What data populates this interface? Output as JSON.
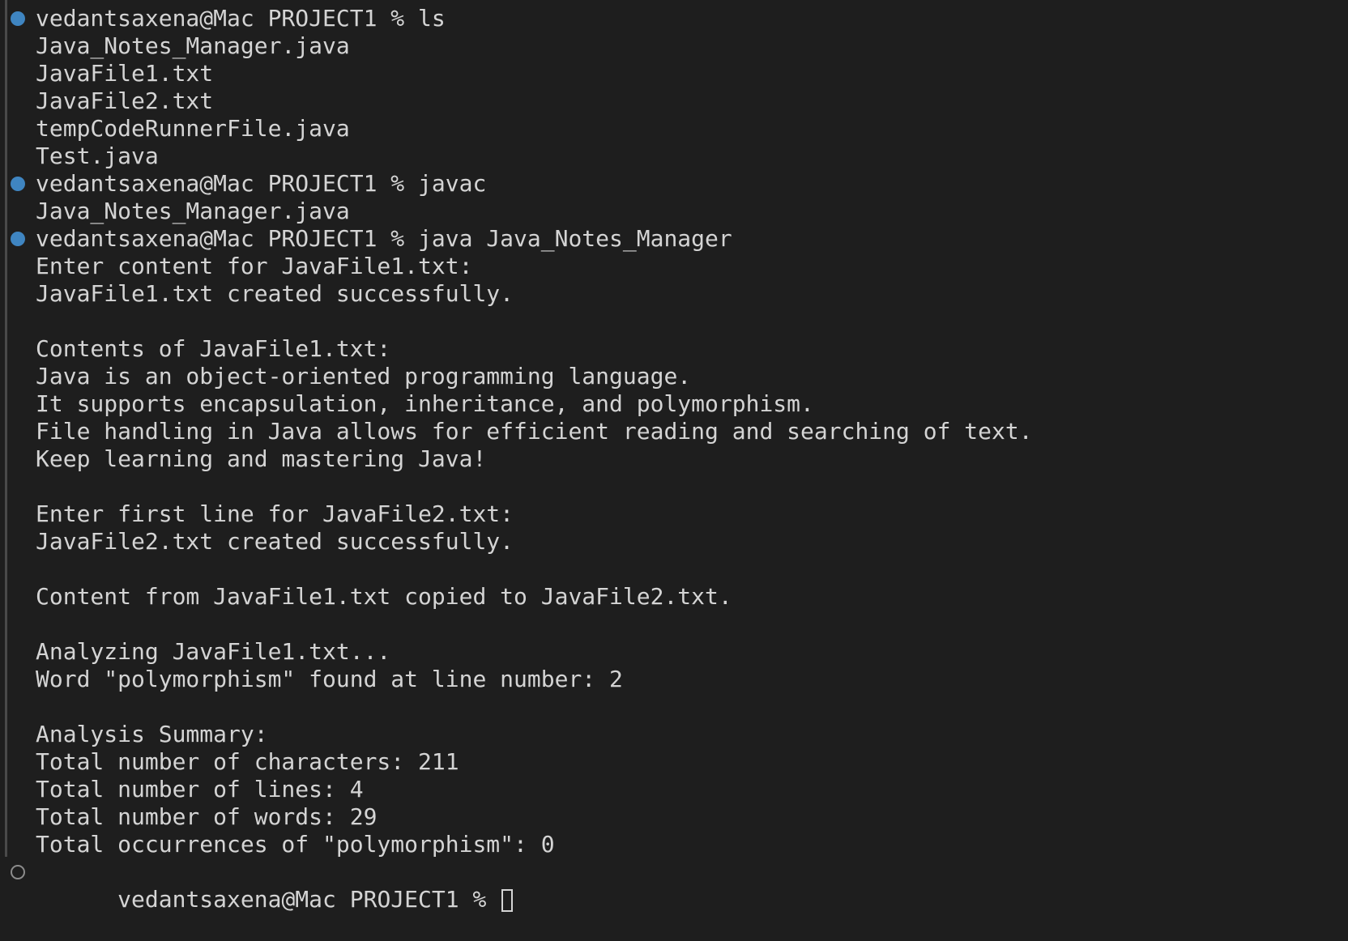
{
  "terminal": {
    "accent_color": "#3f85c1",
    "background": "#1e1e1e",
    "prompt": "vedantsaxena@Mac PROJECT1 %",
    "lines": [
      {
        "text": "vedantsaxena@Mac PROJECT1 % ls",
        "marker": "filled"
      },
      {
        "text": "Java_Notes_Manager.java",
        "marker": "none"
      },
      {
        "text": "JavaFile1.txt",
        "marker": "none"
      },
      {
        "text": "JavaFile2.txt",
        "marker": "none"
      },
      {
        "text": "tempCodeRunnerFile.java",
        "marker": "none"
      },
      {
        "text": "Test.java",
        "marker": "none"
      },
      {
        "text": "vedantsaxena@Mac PROJECT1 % javac",
        "marker": "filled"
      },
      {
        "text": "Java_Notes_Manager.java",
        "marker": "none"
      },
      {
        "text": "vedantsaxena@Mac PROJECT1 % java Java_Notes_Manager",
        "marker": "filled"
      },
      {
        "text": "Enter content for JavaFile1.txt:",
        "marker": "none"
      },
      {
        "text": "JavaFile1.txt created successfully.",
        "marker": "none"
      },
      {
        "text": "",
        "marker": "none"
      },
      {
        "text": "Contents of JavaFile1.txt:",
        "marker": "none"
      },
      {
        "text": "Java is an object-oriented programming language.",
        "marker": "none"
      },
      {
        "text": "It supports encapsulation, inheritance, and polymorphism.",
        "marker": "none"
      },
      {
        "text": "File handling in Java allows for efficient reading and searching of text.",
        "marker": "none"
      },
      {
        "text": "Keep learning and mastering Java!",
        "marker": "none"
      },
      {
        "text": "",
        "marker": "none"
      },
      {
        "text": "Enter first line for JavaFile2.txt:",
        "marker": "none"
      },
      {
        "text": "JavaFile2.txt created successfully.",
        "marker": "none"
      },
      {
        "text": "",
        "marker": "none"
      },
      {
        "text": "Content from JavaFile1.txt copied to JavaFile2.txt.",
        "marker": "none"
      },
      {
        "text": "",
        "marker": "none"
      },
      {
        "text": "Analyzing JavaFile1.txt...",
        "marker": "none"
      },
      {
        "text": "Word \"polymorphism\" found at line number: 2",
        "marker": "none"
      },
      {
        "text": "",
        "marker": "none"
      },
      {
        "text": "Analysis Summary:",
        "marker": "none"
      },
      {
        "text": "Total number of characters: 211",
        "marker": "none"
      },
      {
        "text": "Total number of lines: 4",
        "marker": "none"
      },
      {
        "text": "Total number of words: 29",
        "marker": "none"
      },
      {
        "text": "Total occurrences of \"polymorphism\": 0",
        "marker": "none"
      }
    ],
    "current_prompt": {
      "text": "vedantsaxena@Mac PROJECT1 % ",
      "marker": "empty"
    }
  }
}
